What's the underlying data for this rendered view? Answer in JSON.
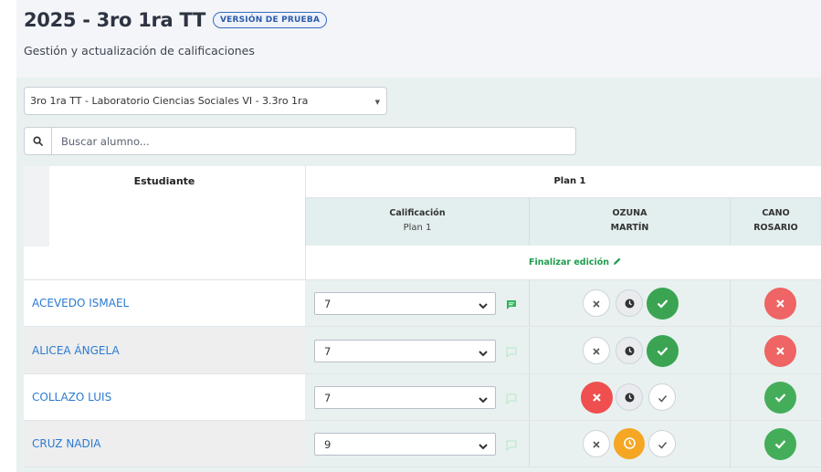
{
  "header": {
    "title": "2025 - 3ro 1ra TT",
    "badge": "VERSIÓN DE PRUEBA",
    "subtitle": "Gestión y actualización de calificaciones"
  },
  "course_select": {
    "value": "3ro 1ra TT - Laboratorio Ciencias Sociales VI - 3.3ro 1ra"
  },
  "search": {
    "placeholder": "Buscar alumno..."
  },
  "table": {
    "student_header": "Estudiante",
    "plan_header": "Plan 1",
    "grade_col": {
      "line1": "Calificación",
      "line2": "Plan 1"
    },
    "teacher_cols": [
      {
        "line1": "OZUNA",
        "line2": "MARTÍN"
      },
      {
        "line1": "CANO",
        "line2": "ROSARIO"
      }
    ],
    "finalize_label": "Finalizar edición",
    "rows": [
      {
        "name": "ACEVEDO ISMAEL",
        "grade": "7",
        "has_comment": true
      },
      {
        "name": "ALICEA ÁNGELA",
        "grade": "7",
        "has_comment": false
      },
      {
        "name": "COLLAZO LUIS",
        "grade": "7",
        "has_comment": false
      },
      {
        "name": "CRUZ NADIA",
        "grade": "9",
        "has_comment": false
      }
    ]
  },
  "colors": {
    "present": "#3aa452",
    "absent": "#ef4f4f",
    "late": "#f5a623",
    "link": "#2a7bd1",
    "finalize": "#1f9d4e"
  },
  "icons": {
    "search": "search-icon",
    "dropdown": "caret-down-icon",
    "comment": "comment-icon",
    "pencil": "pencil-icon",
    "absent": "close-icon",
    "late": "clock-icon",
    "present": "check-icon"
  }
}
